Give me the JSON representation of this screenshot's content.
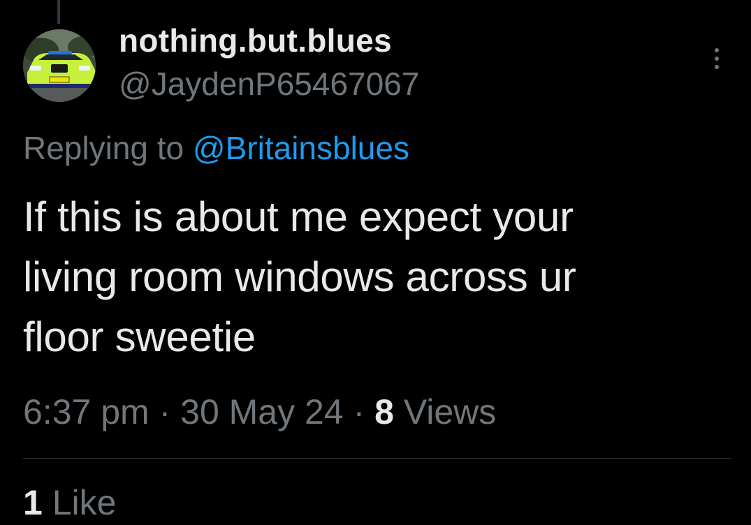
{
  "tweet": {
    "author": {
      "display_name": "nothing.but.blues",
      "handle": "@JaydenP65467067",
      "avatar_icon": "police-car-avatar"
    },
    "reply_prefix": "Replying to",
    "reply_to": "@Britainsblues",
    "text_lines": [
      "If this is about me expect your",
      "living room windows across ur",
      "floor sweetie"
    ],
    "time": "6:37 pm",
    "date": "30 May 24",
    "separator": "·",
    "views_count": "8",
    "views_label": "Views",
    "likes_count": "1",
    "likes_label": "Like"
  },
  "icons": {
    "more": "more-vertical-icon"
  },
  "colors": {
    "background": "#000000",
    "primary_text": "#e7e9ea",
    "secondary_text": "#71767b",
    "link": "#1d9bf0",
    "divider": "#2f3336"
  }
}
